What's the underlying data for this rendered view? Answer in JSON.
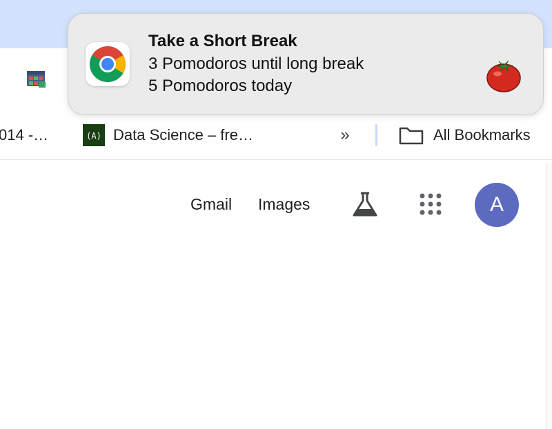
{
  "bookmarks_bar": {
    "partial_item_label": "014 -…",
    "data_science_label": "Data Science – fre…",
    "overflow_chevrons": "»",
    "all_bookmarks_label": "All Bookmarks"
  },
  "google_header": {
    "gmail_label": "Gmail",
    "images_label": "Images",
    "avatar_initial": "A",
    "avatar_color": "#5c6bc0"
  },
  "notification": {
    "title": "Take a Short Break",
    "line1": "3 Pomodoros until long break",
    "line2": "5 Pomodoros today",
    "app_icon": "chrome-icon",
    "image_icon": "tomato-icon"
  },
  "colors": {
    "tab_strip": "#d3e3fd",
    "notification_bg": "#ebebeb"
  }
}
